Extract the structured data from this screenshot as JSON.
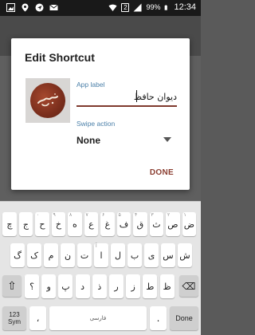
{
  "status_bar": {
    "icons": [
      "image-icon",
      "location-icon",
      "send-icon",
      "mail-icon"
    ],
    "right_icons": [
      "wifi-icon",
      "sim-icon",
      "signal-icon",
      "battery-icon"
    ],
    "sim_label": "2",
    "battery": "99%",
    "time": "12:34"
  },
  "dialog": {
    "title": "Edit Shortcut",
    "app_label_caption": "App label",
    "app_label_value": "دیوان حافظ",
    "swipe_action_caption": "Swipe action",
    "swipe_action_value": "None",
    "done_label": "DONE"
  },
  "keyboard": {
    "row1": [
      {
        "ch": "ض",
        "hint": "۱"
      },
      {
        "ch": "ص",
        "hint": "۲"
      },
      {
        "ch": "ث",
        "hint": "۳"
      },
      {
        "ch": "ق",
        "hint": "۴"
      },
      {
        "ch": "ف",
        "hint": "۵"
      },
      {
        "ch": "غ",
        "hint": "۶"
      },
      {
        "ch": "ع",
        "hint": "۷"
      },
      {
        "ch": "ه",
        "hint": "۸"
      },
      {
        "ch": "خ",
        "hint": "۹"
      },
      {
        "ch": "ح",
        "hint": "۰"
      },
      {
        "ch": "ج",
        "hint": ""
      },
      {
        "ch": "چ",
        "hint": ""
      }
    ],
    "row2": [
      {
        "ch": "ش",
        "hint": ""
      },
      {
        "ch": "س",
        "hint": ""
      },
      {
        "ch": "ی",
        "hint": ""
      },
      {
        "ch": "ب",
        "hint": ""
      },
      {
        "ch": "ل",
        "hint": ""
      },
      {
        "ch": "ا",
        "hint": "آ"
      },
      {
        "ch": "ت",
        "hint": ""
      },
      {
        "ch": "ن",
        "hint": ""
      },
      {
        "ch": "م",
        "hint": ""
      },
      {
        "ch": "ک",
        "hint": ""
      },
      {
        "ch": "گ",
        "hint": ""
      }
    ],
    "row3": [
      {
        "ch": "ظ",
        "hint": ""
      },
      {
        "ch": "ط",
        "hint": ""
      },
      {
        "ch": "ز",
        "hint": ""
      },
      {
        "ch": "ر",
        "hint": ""
      },
      {
        "ch": "ذ",
        "hint": ""
      },
      {
        "ch": "د",
        "hint": ""
      },
      {
        "ch": "پ",
        "hint": ""
      },
      {
        "ch": "و",
        "hint": ""
      },
      {
        "ch": "؟",
        "hint": ""
      }
    ],
    "shift_label": "⇧",
    "backspace_label": "⌫",
    "sym_label": "123\nSym",
    "comma_label": "،",
    "space_label": "فارسی",
    "period_label": ".",
    "done_label": "Done"
  },
  "colors": {
    "accent": "#8a3d30",
    "caption": "#4a7fa8",
    "icon_bg": "#7a2e1c"
  }
}
